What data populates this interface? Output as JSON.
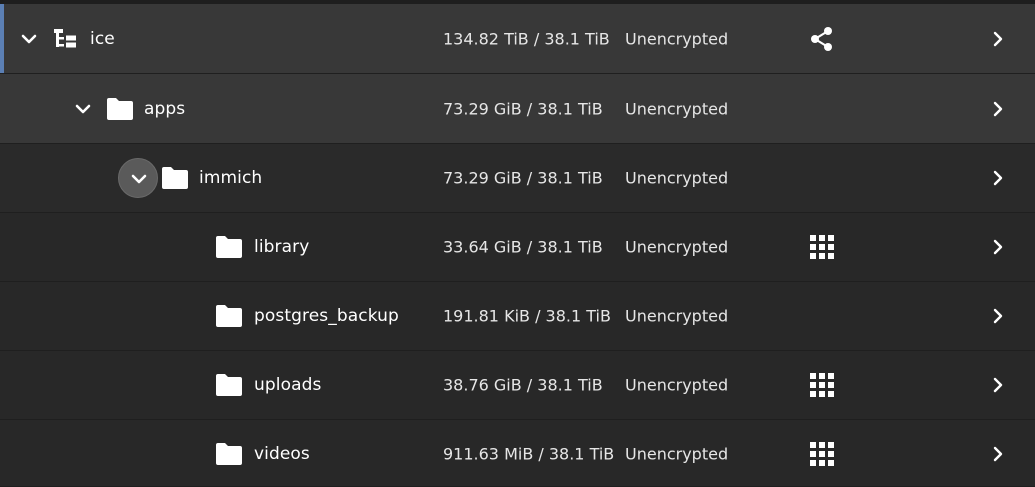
{
  "colors": {
    "background": "#282828",
    "expanded_row_bg": "#383838",
    "selection_accent": "#5b7fb4",
    "text": "#ffffff"
  },
  "rows": [
    {
      "name": "ice",
      "used": "134.82 TiB / 38.1 TiB",
      "encryption": "Unencrypted",
      "icon": "dataset-tree-icon",
      "indicator": "share-icon"
    },
    {
      "name": "apps",
      "used": "73.29 GiB / 38.1 TiB",
      "encryption": "Unencrypted",
      "icon": "folder-icon",
      "indicator": ""
    },
    {
      "name": "immich",
      "used": "73.29 GiB / 38.1 TiB",
      "encryption": "Unencrypted",
      "icon": "folder-icon",
      "indicator": ""
    },
    {
      "name": "library",
      "used": "33.64 GiB / 38.1 TiB",
      "encryption": "Unencrypted",
      "icon": "folder-icon",
      "indicator": "apps-grid-icon"
    },
    {
      "name": "postgres_backup",
      "used": "191.81 KiB / 38.1 TiB",
      "encryption": "Unencrypted",
      "icon": "folder-icon",
      "indicator": ""
    },
    {
      "name": "uploads",
      "used": "38.76 GiB / 38.1 TiB",
      "encryption": "Unencrypted",
      "icon": "folder-icon",
      "indicator": "apps-grid-icon"
    },
    {
      "name": "videos",
      "used": "911.63 MiB / 38.1 TiB",
      "encryption": "Unencrypted",
      "icon": "folder-icon",
      "indicator": "apps-grid-icon"
    }
  ]
}
